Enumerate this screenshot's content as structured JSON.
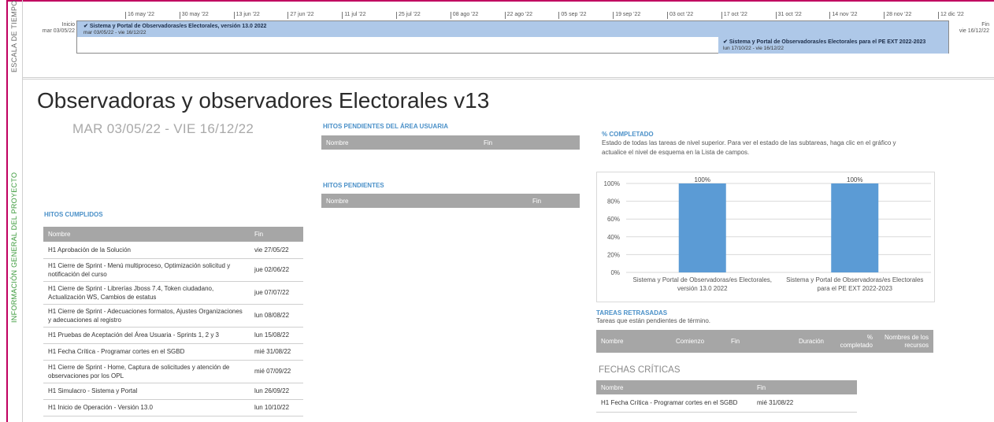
{
  "side_labels": {
    "timeline": "ESCALA DE TIEMPO",
    "overview": "INFORMACIÓN GENERAL DEL PROYECTO"
  },
  "timeline": {
    "start_label": "Inicio",
    "start_date": "mar 03/05/22",
    "end_label": "Fin",
    "end_date": "vie 16/12/22",
    "ticks": [
      "16 may '22",
      "30 may '22",
      "13 jun '22",
      "27 jun '22",
      "11 jul '22",
      "25 jul '22",
      "08 ago '22",
      "22 ago '22",
      "05 sep '22",
      "19 sep '22",
      "03 oct '22",
      "17 oct '22",
      "31 oct '22",
      "14 nov '22",
      "28 nov '22",
      "12 dic '22"
    ],
    "bars": [
      {
        "title": "Sistema y Portal de Observadoras/es Electorales, versión 13.0 2022",
        "dates": "mar 03/05/22 - vie 16/12/22"
      },
      {
        "title": "Sistema y Portal de Observadoras/es Electorales para el PE EXT 2022-2023",
        "dates": "lun 17/10/22 - vie 16/12/22"
      }
    ]
  },
  "project": {
    "title": "Observadoras y observadores Electorales v13",
    "dates": "MAR 03/05/22 - VIE 16/12/22"
  },
  "milestones_done": {
    "title": "HITOS CUMPLIDOS",
    "headers": [
      "Nombre",
      "Fin"
    ],
    "rows": [
      {
        "name": "H1 Aprobación de la Solución",
        "end": "vie 27/05/22"
      },
      {
        "name": "H1 Cierre de Sprint - Menú multiproceso, Optimización solicitud y notificación del curso",
        "end": "jue 02/06/22"
      },
      {
        "name": "H1 Cierre de Sprint - Librerías Jboss 7.4, Token ciudadano, Actualización WS, Cambios de estatus",
        "end": "jue 07/07/22"
      },
      {
        "name": "H1 Cierre de Sprint - Adecuaciones formatos, Ajustes Organizaciones y adecuaciones al registro",
        "end": "lun 08/08/22"
      },
      {
        "name": "H1 Pruebas de Aceptación del Área Usuaria - Sprints 1, 2 y 3",
        "end": "lun 15/08/22"
      },
      {
        "name": "H1 Fecha Crítica - Programar cortes en el SGBD",
        "end": "mié 31/08/22"
      },
      {
        "name": "H1 Cierre de Sprint - Home, Captura de solicitudes y atención de observaciones por los OPL",
        "end": "mié 07/09/22"
      },
      {
        "name": "H1 Simulacro - Sistema y Portal",
        "end": "lun 26/09/22"
      },
      {
        "name": "H1 Inicio de Operación - Versión 13.0",
        "end": "lun 10/10/22"
      }
    ]
  },
  "milestones_pending_user": {
    "title": "HITOS PENDIENTES DEL ÁREA USUARIA",
    "headers": [
      "Nombre",
      "Fin"
    ]
  },
  "milestones_pending": {
    "title": "HITOS PENDIENTES",
    "headers": [
      "Nombre",
      "Fin"
    ]
  },
  "percent_complete": {
    "title": "% COMPLETADO",
    "description": "Estado de todas las tareas de nivel superior. Para ver el estado de las subtareas, haga clic en el gráfico y actualice el nivel de esquema en la Lista de campos."
  },
  "chart_data": {
    "type": "bar",
    "categories": [
      "Sistema y Portal de Observadoras/es Electorales, versión 13.0 2022",
      "Sistema y Portal de Observadoras/es Electorales para el PE EXT 2022-2023"
    ],
    "category_lines": [
      [
        "Sistema y Portal de Observadoras/es Electorales,",
        "versión 13.0 2022"
      ],
      [
        "Sistema y Portal de Observadoras/es Electorales",
        "para el PE EXT 2022-2023"
      ]
    ],
    "values": [
      100,
      100
    ],
    "value_labels": [
      "100%",
      "100%"
    ],
    "yticks": [
      "0%",
      "20%",
      "40%",
      "60%",
      "80%",
      "100%"
    ],
    "ylim": [
      0,
      100
    ],
    "grid": true,
    "bar_color": "#5b9bd5"
  },
  "delayed_tasks": {
    "title": "TAREAS RETRASADAS",
    "description": "Tareas que están pendientes de término.",
    "headers": [
      "Nombre",
      "Comienzo",
      "Fin",
      "Duración",
      "% completado",
      "Nombres de los recursos"
    ]
  },
  "critical_dates": {
    "title": "FECHAS CRÍTICAS",
    "headers": [
      "Nombre",
      "Fin"
    ],
    "rows": [
      {
        "name": "H1 Fecha Crítica - Programar cortes en el SGBD",
        "end": "mié 31/08/22"
      }
    ]
  },
  "colors": {
    "frame": "#c00060",
    "timeline_bar": "#aec8e8",
    "section_title": "#4a90c8",
    "table_header": "#a6a6a6",
    "overview_label": "#3b9a3b"
  }
}
